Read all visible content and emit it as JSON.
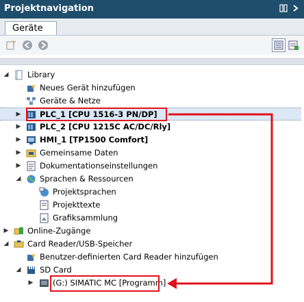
{
  "window": {
    "title": "Projektnavigation"
  },
  "tabs": [
    {
      "label": "Geräte"
    }
  ],
  "tree": {
    "items": [
      {
        "label": "Library"
      },
      {
        "label": "Neues Gerät hinzufügen"
      },
      {
        "label": "Geräte & Netze"
      },
      {
        "label": "PLC_1 [CPU 1516-3 PN/DP]"
      },
      {
        "label": "PLC_2 [CPU 1215C AC/DC/Rly]"
      },
      {
        "label": "HMI_1 [TP1500 Comfort]"
      },
      {
        "label": "Gemeinsame Daten"
      },
      {
        "label": "Dokumentationseinstellungen"
      },
      {
        "label": "Sprachen & Ressourcen"
      },
      {
        "label": "Projektsprachen"
      },
      {
        "label": "Projekttexte"
      },
      {
        "label": "Grafiksammlung"
      },
      {
        "label": "Online-Zugänge"
      },
      {
        "label": "Card Reader/USB-Speicher"
      },
      {
        "label": "Benutzer-definierten Card Reader hinzufügen"
      },
      {
        "label": "SD Card"
      },
      {
        "label": "(G:) SIMATIC MC [Programm]"
      }
    ]
  },
  "colors": {
    "titlebar": "#1f4e6d",
    "annotation": "#e0121b",
    "selection": "#dce8f5"
  }
}
